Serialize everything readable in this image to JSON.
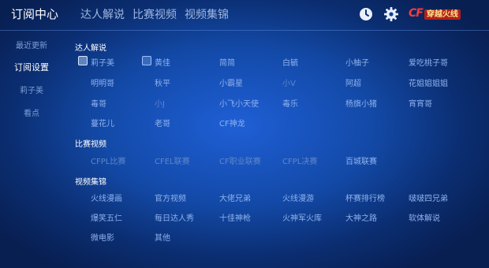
{
  "header": {
    "tabs": [
      {
        "label": "订阅中心"
      },
      {
        "label": "达人解说"
      },
      {
        "label": "比赛视频"
      },
      {
        "label": "视频集锦"
      }
    ],
    "icons": [
      "clock-icon",
      "gear-icon"
    ],
    "logo": {
      "mark": "CF",
      "name": "穿越火线"
    }
  },
  "sidebar": {
    "items": [
      {
        "label": "最近更新"
      },
      {
        "label": "订阅设置"
      },
      {
        "label": "莉子美"
      },
      {
        "label": "看点"
      }
    ]
  },
  "sections": [
    {
      "title": "达人解说",
      "rows": [
        [
          "莉子美",
          "黄佳",
          "简简",
          "白毓",
          "小柚子",
          "爱吃桃子哥"
        ],
        [
          "明明哥",
          "秋平",
          "小霸星",
          "小V",
          "阿超",
          "花姐姐姐姐"
        ],
        [
          "毒哥",
          "小J",
          "小飞小天使",
          "毒乐",
          "杨旗小猪",
          "宵宵哥"
        ],
        [
          "蔓花儿",
          "老哥",
          "CF神龙"
        ]
      ]
    },
    {
      "title": "比赛视频",
      "rows": [
        [
          "CFPL比赛",
          "CFEL联赛",
          "CF职业联赛",
          "CFPL决赛",
          "百城联赛"
        ]
      ]
    },
    {
      "title": "视频集锦",
      "rows": [
        [
          "火线漫画",
          "官方视频",
          "大佬兄弟",
          "火线漫游",
          "杯赛排行榜",
          "啵啵四兄弟"
        ],
        [
          "爆笑五仁",
          "每日达人秀",
          "十佳神枪",
          "火神军火库",
          "大神之路",
          "软体解说"
        ],
        [
          "微电影",
          "其他"
        ]
      ]
    }
  ]
}
